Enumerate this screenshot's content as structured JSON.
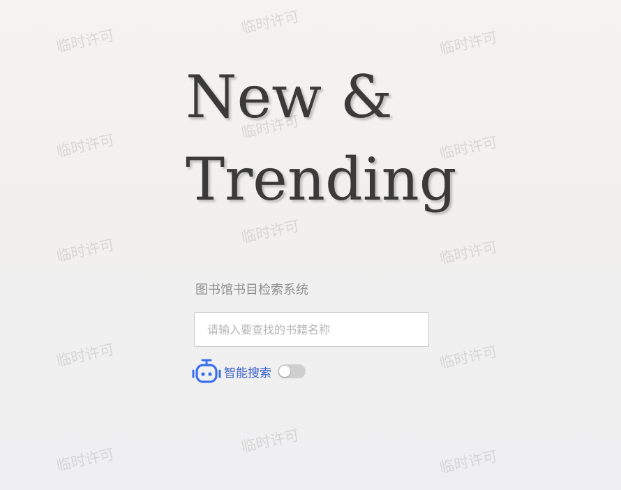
{
  "hero": {
    "line1": "New &",
    "line2": "Trending"
  },
  "subtitle": "图书馆书目检索系统",
  "search": {
    "placeholder": "请输入要查找的书籍名称",
    "value": ""
  },
  "smart_search": {
    "label": "智能搜索",
    "icon": "robot-icon",
    "enabled": false
  },
  "watermark": {
    "text": "临时许可"
  },
  "colors": {
    "accent": "#3a62c9",
    "title": "#3a3a3a",
    "subtitle": "#8e8e8e",
    "toggle_off": "#cfcfcf"
  }
}
